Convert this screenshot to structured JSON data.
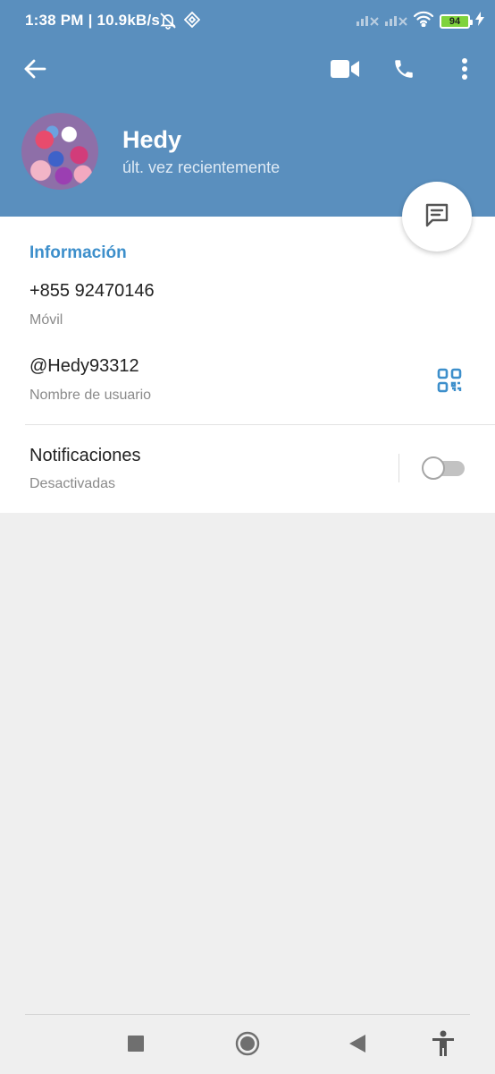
{
  "status_bar": {
    "time": "1:38 PM | 10.9kB/s",
    "battery": "94"
  },
  "toolbar": {
    "back_icon": "arrow-left-icon",
    "video_icon": "video-camera-icon",
    "call_icon": "phone-icon",
    "menu_icon": "more-vertical-icon"
  },
  "profile": {
    "name": "Hedy",
    "status": "últ. vez recientemente"
  },
  "info": {
    "section_title": "Información",
    "phone": "+855 92470146",
    "phone_label": "Móvil",
    "username": "@Hedy93312",
    "username_label": "Nombre de usuario",
    "notifications": "Notificaciones",
    "notifications_state": "Desactivadas",
    "notifications_enabled": false
  },
  "colors": {
    "header": "#5a8fbe",
    "accent": "#3d8fcb"
  }
}
